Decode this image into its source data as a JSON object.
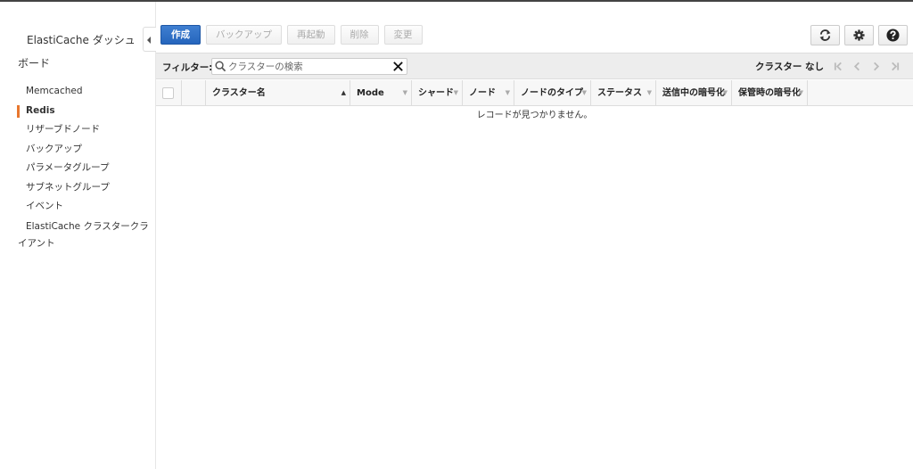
{
  "sidebar": {
    "title": "ElastiCache ダッシュボード",
    "items": [
      {
        "label": "Memcached"
      },
      {
        "label": "Redis"
      },
      {
        "label": "リザーブドノード"
      },
      {
        "label": "バックアップ"
      },
      {
        "label": "パラメータグループ"
      },
      {
        "label": "サブネットグループ"
      },
      {
        "label": "イベント"
      },
      {
        "label": "ElastiCache クラスタークライアント"
      }
    ]
  },
  "toolbar": {
    "create_label": "作成",
    "backup_label": "バックアップ",
    "reboot_label": "再起動",
    "delete_label": "削除",
    "modify_label": "変更"
  },
  "filter": {
    "label": "フィルター:",
    "placeholder": "クラスターの検索"
  },
  "pager": {
    "text": "クラスター なし"
  },
  "table": {
    "columns": [
      "クラスター名",
      "Mode",
      "シャード",
      "ノード",
      "ノードのタイプ",
      "ステータス",
      "送信中の暗号化",
      "保管時の暗号化"
    ],
    "empty_message": "レコードが見つかりません。"
  },
  "colors": {
    "primary": "#2565bd",
    "active_indicator": "#e8772e"
  }
}
